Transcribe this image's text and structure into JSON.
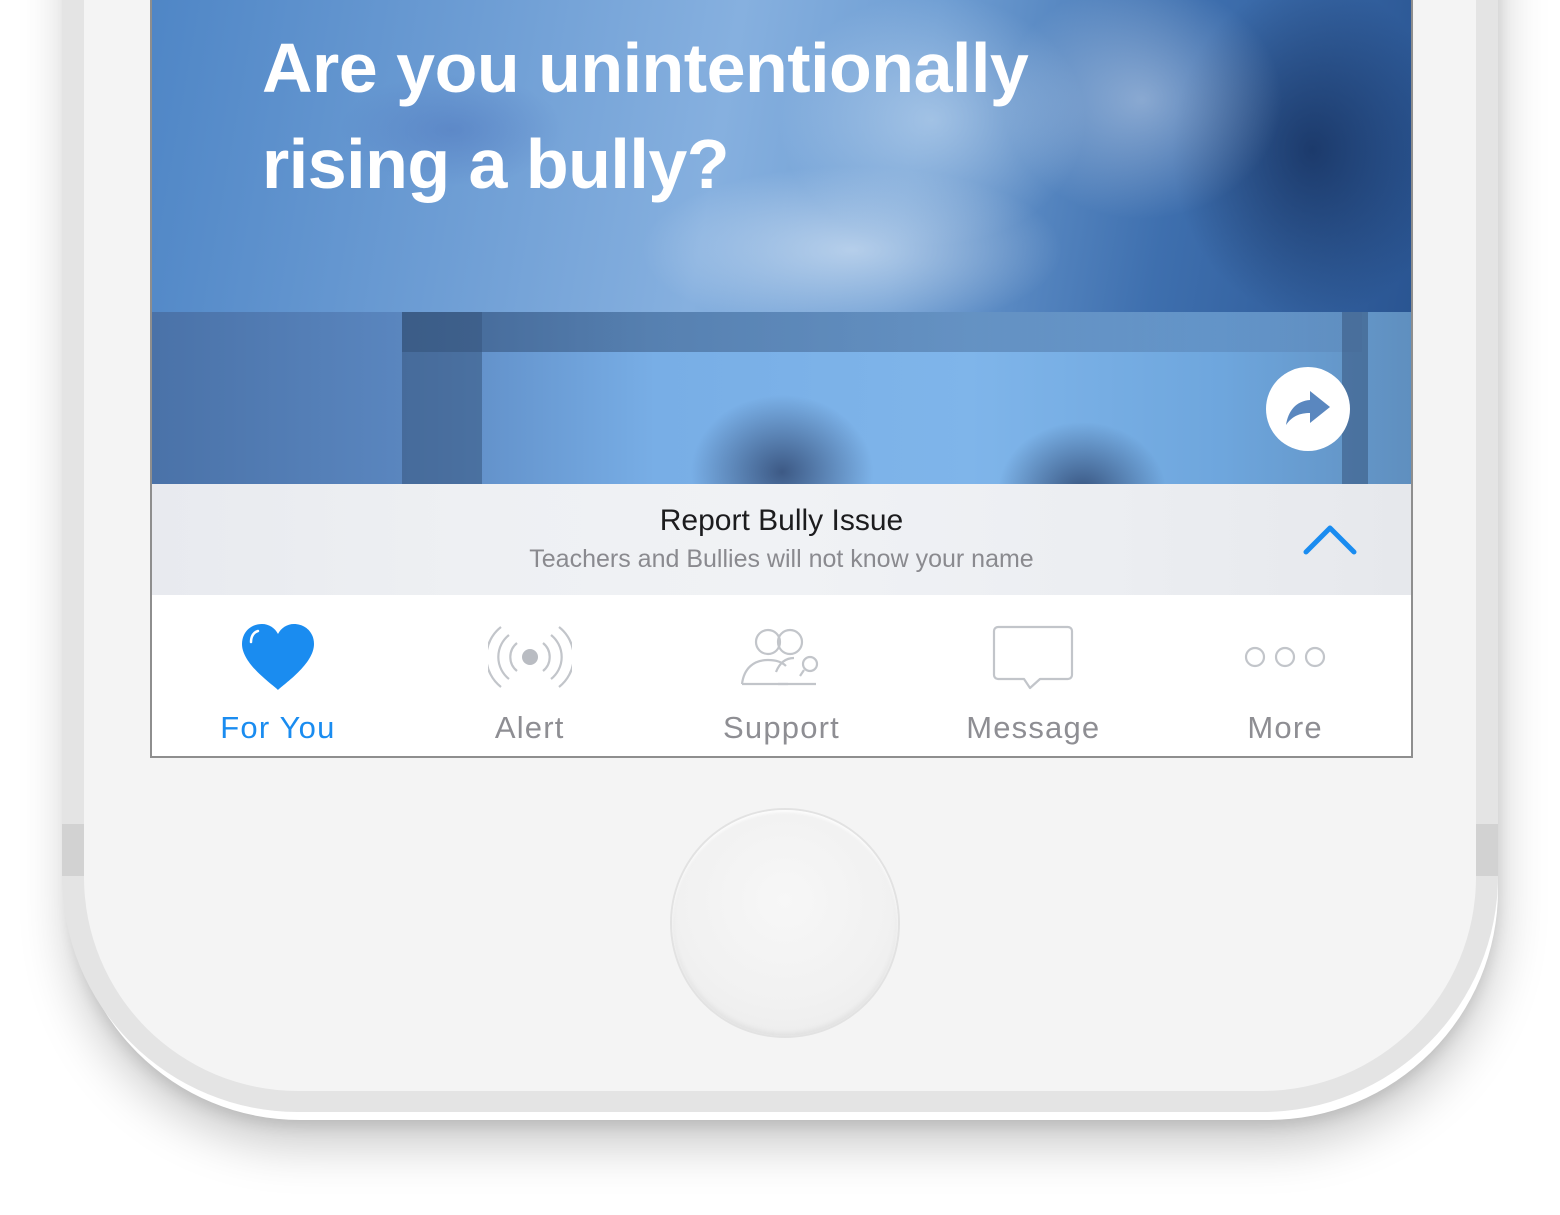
{
  "article": {
    "headline_line1": "Are you unintentionally",
    "headline_line2": "rising a bully?"
  },
  "report": {
    "title": "Report Bully Issue",
    "subtitle": "Teachers and Bullies will not know your name"
  },
  "tabs": [
    {
      "label": "For You",
      "icon": "heart-icon",
      "active": true
    },
    {
      "label": "Alert",
      "icon": "broadcast-icon",
      "active": false
    },
    {
      "label": "Support",
      "icon": "people-icon",
      "active": false
    },
    {
      "label": "Message",
      "icon": "speech-bubble-icon",
      "active": false
    },
    {
      "label": "More",
      "icon": "more-dots-icon",
      "active": false
    }
  ],
  "colors": {
    "accent": "#1a8cf0",
    "inactive": "#8e8e93",
    "photo_tint": "#6d9dd4"
  }
}
